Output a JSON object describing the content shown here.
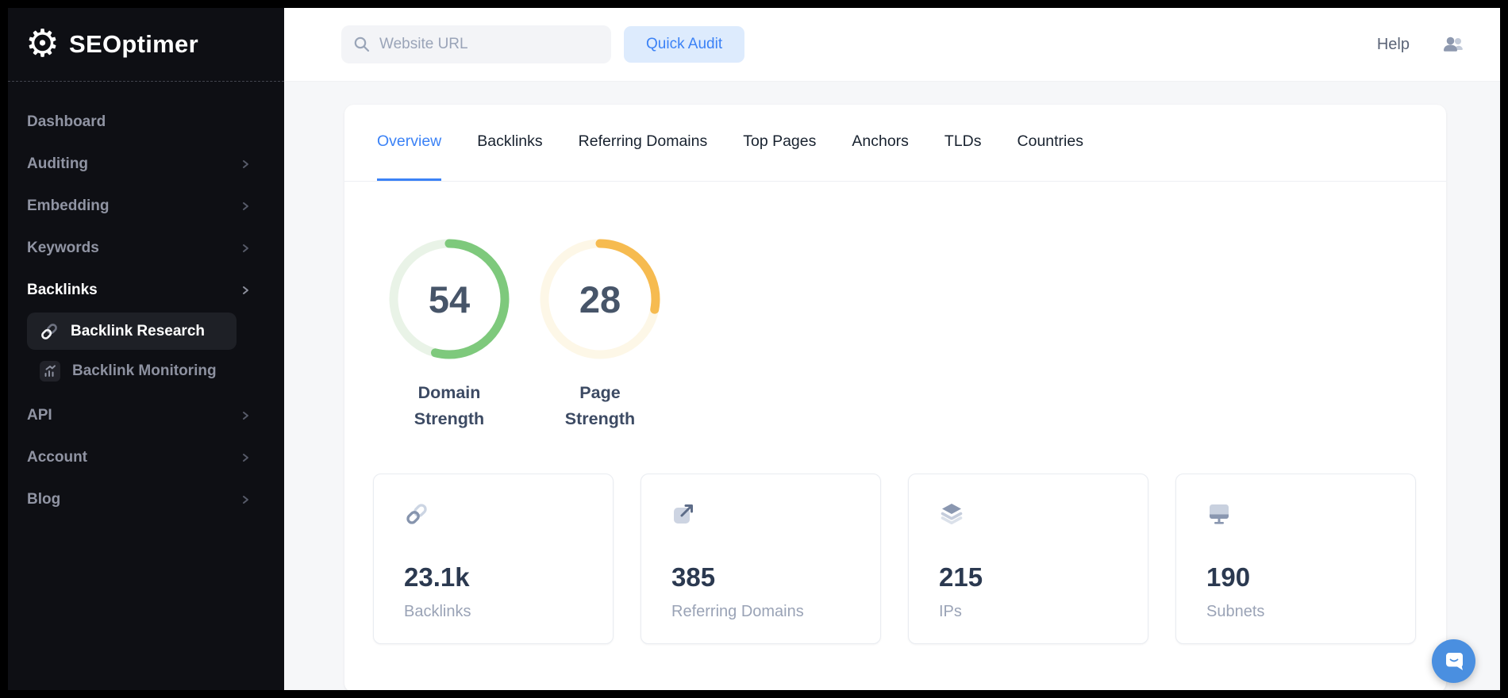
{
  "brand": {
    "name": "SEOptimer"
  },
  "sidebar": {
    "items": [
      {
        "label": "Dashboard",
        "chevron": false
      },
      {
        "label": "Auditing",
        "chevron": true
      },
      {
        "label": "Embedding",
        "chevron": true
      },
      {
        "label": "Keywords",
        "chevron": true
      },
      {
        "label": "Backlinks",
        "chevron": true,
        "active": true
      },
      {
        "label": "API",
        "chevron": true
      },
      {
        "label": "Account",
        "chevron": true
      },
      {
        "label": "Blog",
        "chevron": true
      }
    ],
    "submenu": [
      {
        "label": "Backlink Research",
        "active": true
      },
      {
        "label": "Backlink Monitoring",
        "active": false
      }
    ]
  },
  "topbar": {
    "search_placeholder": "Website URL",
    "quick_audit_label": "Quick Audit",
    "help_label": "Help"
  },
  "tabs": [
    {
      "label": "Overview",
      "active": true
    },
    {
      "label": "Backlinks",
      "active": false
    },
    {
      "label": "Referring Domains",
      "active": false
    },
    {
      "label": "Top Pages",
      "active": false
    },
    {
      "label": "Anchors",
      "active": false
    },
    {
      "label": "TLDs",
      "active": false
    },
    {
      "label": "Countries",
      "active": false
    }
  ],
  "gauges": [
    {
      "value": 54,
      "max": 100,
      "label": "Domain Strength",
      "color": "#7ec97c",
      "track_color": "#e9f3e7"
    },
    {
      "value": 28,
      "max": 100,
      "label": "Page Strength",
      "color": "#f6bb50",
      "track_color": "#fdf7e7"
    }
  ],
  "stats": [
    {
      "icon": "link-icon",
      "value": "23.1k",
      "label": "Backlinks"
    },
    {
      "icon": "external-link-icon",
      "value": "385",
      "label": "Referring Domains"
    },
    {
      "icon": "layers-icon",
      "value": "215",
      "label": "IPs"
    },
    {
      "icon": "monitor-icon",
      "value": "190",
      "label": "Subnets"
    }
  ],
  "colors": {
    "accent_blue": "#3b82f6",
    "gauge_green": "#7ec97c",
    "gauge_amber": "#f6bb50",
    "sidebar_bg": "#0e0f14",
    "chat_fab_blue": "#4a8fe0"
  }
}
